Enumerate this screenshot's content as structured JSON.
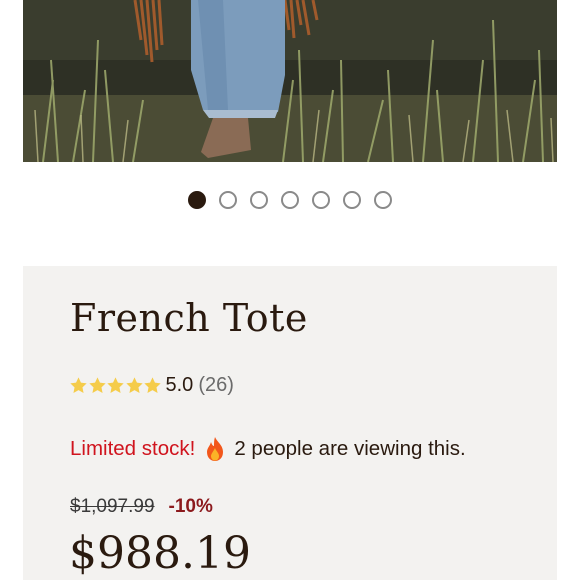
{
  "carousel": {
    "dots": [
      {
        "active": true
      },
      {
        "active": false
      },
      {
        "active": false
      },
      {
        "active": false
      },
      {
        "active": false
      },
      {
        "active": false
      },
      {
        "active": false
      }
    ]
  },
  "product": {
    "title": "French Tote",
    "rating_value": "5.0",
    "rating_count": "(26)",
    "stars": 5,
    "stock_warning": "Limited stock!",
    "viewing_text": "2 people are viewing this.",
    "original_price": "$1,097.99",
    "discount": "-10%",
    "price": "$988.19"
  },
  "colors": {
    "star": "#f5cc4a",
    "warning": "#d0141e",
    "discount": "#8c1a1d",
    "text": "#2a1a0f"
  },
  "icons": {
    "fire": "fire-icon",
    "star": "star-icon"
  }
}
